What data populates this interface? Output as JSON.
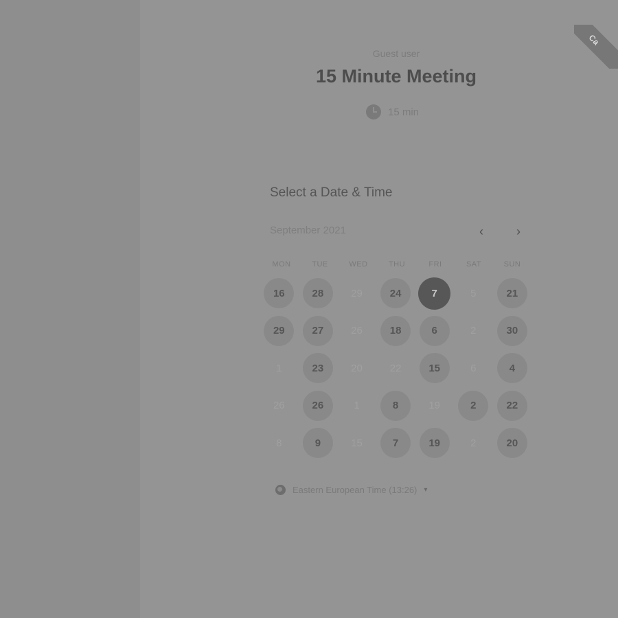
{
  "ribbon": {
    "text": "Ca"
  },
  "event": {
    "host": "Guest user",
    "title": "15 Minute Meeting",
    "duration": "15 min"
  },
  "scheduler": {
    "section_title": "Select a Date & Time",
    "month_label": "September 2021",
    "prev_label": "‹",
    "next_label": "›",
    "weekdays": [
      "MON",
      "TUE",
      "WED",
      "THU",
      "FRI",
      "SAT",
      "SUN"
    ],
    "rows": [
      [
        {
          "label": "16",
          "state": "available"
        },
        {
          "label": "28",
          "state": "available"
        },
        {
          "label": "29",
          "state": "disabled"
        },
        {
          "label": "24",
          "state": "available"
        },
        {
          "label": "7",
          "state": "selected"
        },
        {
          "label": "5",
          "state": "disabled"
        },
        {
          "label": "21",
          "state": "available"
        }
      ],
      [
        {
          "label": "29",
          "state": "available"
        },
        {
          "label": "27",
          "state": "available"
        },
        {
          "label": "26",
          "state": "disabled"
        },
        {
          "label": "18",
          "state": "available"
        },
        {
          "label": "6",
          "state": "available"
        },
        {
          "label": "2",
          "state": "disabled"
        },
        {
          "label": "30",
          "state": "available"
        }
      ],
      [
        {
          "label": "1",
          "state": "disabled"
        },
        {
          "label": "23",
          "state": "available"
        },
        {
          "label": "20",
          "state": "disabled"
        },
        {
          "label": "22",
          "state": "disabled"
        },
        {
          "label": "15",
          "state": "available"
        },
        {
          "label": "6",
          "state": "disabled"
        },
        {
          "label": "4",
          "state": "available"
        }
      ],
      [
        {
          "label": "26",
          "state": "disabled"
        },
        {
          "label": "26",
          "state": "available"
        },
        {
          "label": "1",
          "state": "disabled"
        },
        {
          "label": "8",
          "state": "available"
        },
        {
          "label": "19",
          "state": "disabled"
        },
        {
          "label": "2",
          "state": "available"
        },
        {
          "label": "22",
          "state": "available"
        }
      ],
      [
        {
          "label": "8",
          "state": "disabled"
        },
        {
          "label": "9",
          "state": "available"
        },
        {
          "label": "15",
          "state": "disabled"
        },
        {
          "label": "7",
          "state": "available"
        },
        {
          "label": "19",
          "state": "available"
        },
        {
          "label": "2",
          "state": "disabled"
        },
        {
          "label": "20",
          "state": "available"
        }
      ]
    ],
    "timezone": "Eastern European Time (13:26)",
    "timezone_caret": "▾"
  },
  "colors": {
    "background": "#8e8e8e",
    "panel": "#949494",
    "selected_day": "#575757"
  }
}
